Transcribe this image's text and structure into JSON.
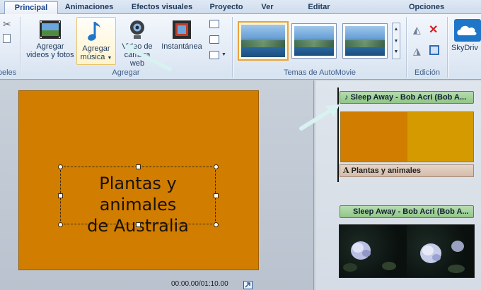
{
  "tabs": [
    {
      "label": "Principal",
      "active": true
    },
    {
      "label": "Animaciones",
      "active": false
    },
    {
      "label": "Efectos visuales",
      "active": false
    },
    {
      "label": "Proyecto",
      "active": false
    },
    {
      "label": "Ver",
      "active": false
    },
    {
      "label": "Editar",
      "active": false
    },
    {
      "label": "Opciones",
      "active": false
    }
  ],
  "ribbon": {
    "left_group_label": "peles",
    "agregar": {
      "group_label": "Agregar",
      "videos_fotos_line1": "Agregar",
      "videos_fotos_line2": "videos y fotos",
      "musica_line1": "Agregar",
      "musica_line2": "música",
      "webcam_line1": "Video de",
      "webcam_line2": "cámara web",
      "snapshot": "Instantánea"
    },
    "themes_group_label": "Temas de AutoMovie",
    "edicion_group_label": "Edición",
    "skydrive_label": "SkyDriv"
  },
  "preview": {
    "title_line1": "Plantas y animales",
    "title_line2": "de Australia",
    "background_color": "#d17d00",
    "timecode": "00:00.00/01:10.00"
  },
  "storyboard": {
    "audio1_label": "Sleep Away - Bob Acri (Bob A...",
    "caption_label": "Plantas y animales",
    "audio2_label": "Sleep Away - Bob Acri (Bob A..."
  },
  "colors": {
    "accent": "#15428b",
    "audio_green": "#91c686",
    "clip_orange": "#d17d00",
    "clip_gold": "#d49a00"
  },
  "icons": [
    "scissors-icon",
    "copy-icon",
    "film-photo-icon",
    "music-note-icon",
    "webcam-icon",
    "snapshot-icon",
    "rotate-left-icon",
    "delete-x-icon",
    "select-all-icon",
    "skydrive-cloud-icon",
    "text-icon",
    "expand-icon"
  ]
}
